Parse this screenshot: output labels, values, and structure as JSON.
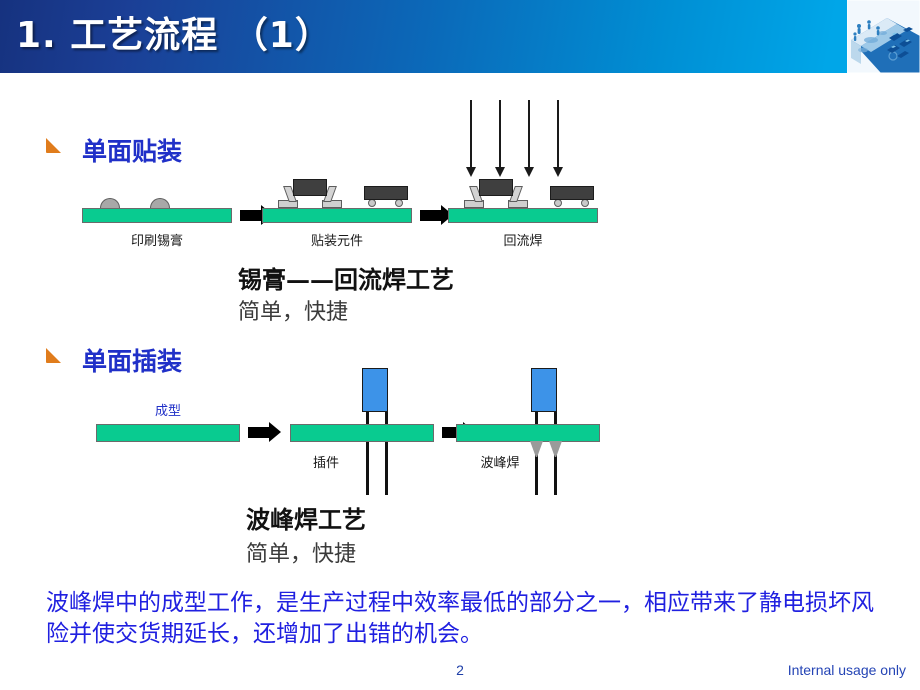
{
  "header": {
    "title": "1. 工艺流程 （1）",
    "gradient_from": "#16327f",
    "gradient_to": "#00a9ea",
    "thumbnail_icon": "pcb-isometric-illustration"
  },
  "accent_colors": {
    "bullet_orange": "#e07c1c",
    "heading_blue": "#2030c8",
    "pcb_green": "#09cb90",
    "component_blue": "#3d93e8",
    "component_dark": "#3f3f3f",
    "note_blue": "#2020e0"
  },
  "sections": [
    {
      "id": "smt",
      "bullet_icon": "orange-wedge-bullet",
      "heading": "单面贴装",
      "stages": [
        {
          "label": "印刷锡膏"
        },
        {
          "label": "贴装元件"
        },
        {
          "label": "回流焊"
        }
      ],
      "caption_bold": "锡膏——回流焊工艺",
      "caption_regular": "简单，快捷"
    },
    {
      "id": "tht",
      "bullet_icon": "orange-wedge-bullet",
      "heading": "单面插装",
      "stages": [
        {
          "label": "成型"
        },
        {
          "label": "插件"
        },
        {
          "label": "波峰焊"
        }
      ],
      "caption_bold": "波峰焊工艺",
      "caption_regular": "简单，快捷"
    }
  ],
  "bottom_note": "波峰焊中的成型工作，是生产过程中效率最低的部分之一，相应带来了静电损坏风险并使交货期延长，还增加了出错的机会。",
  "footer": {
    "page_number": "2",
    "usage_note": "Internal usage only"
  }
}
